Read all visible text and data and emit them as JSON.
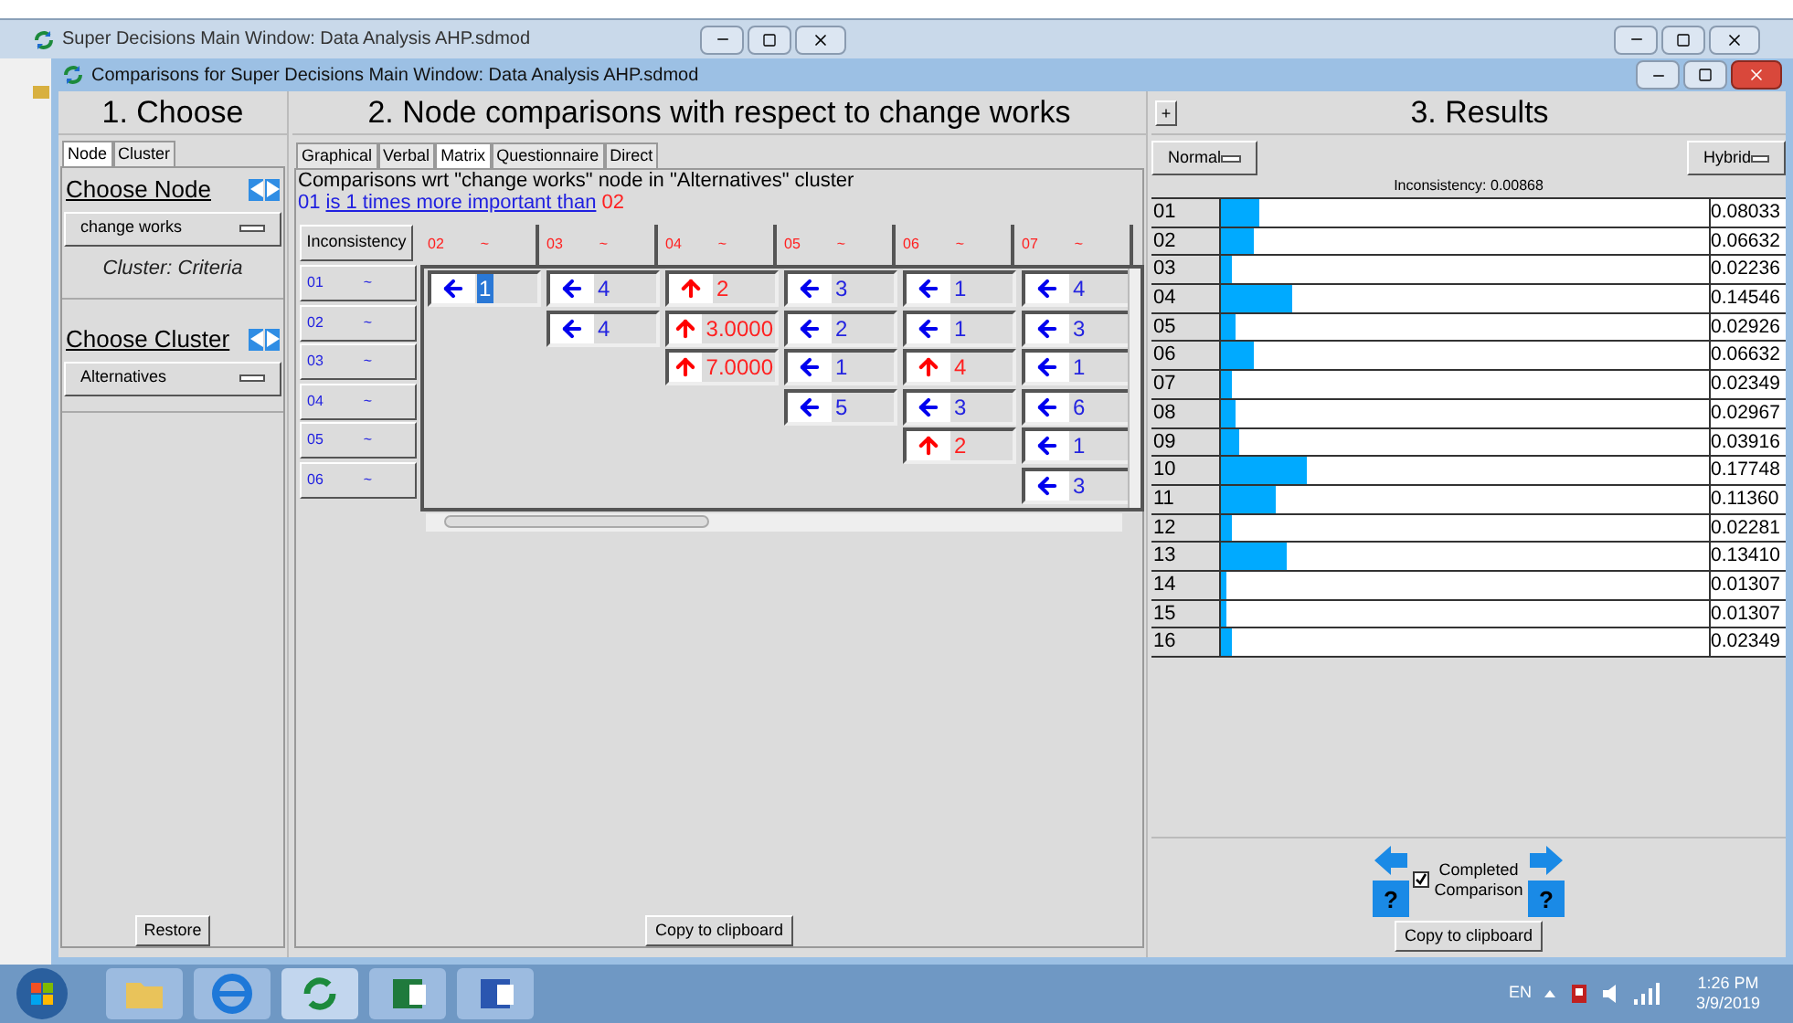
{
  "background_window": {
    "title": "Super Decisions Main Window: Data Analysis AHP.sdmod"
  },
  "window": {
    "title": "Comparisons for Super Decisions Main Window: Data Analysis AHP.sdmod"
  },
  "choose_panel": {
    "heading": "1. Choose",
    "tabs": [
      {
        "label": "Node",
        "selected": true
      },
      {
        "label": "Cluster",
        "selected": false
      }
    ],
    "node_label": "Choose Node",
    "node_dropdown": "change works",
    "cluster_caption": "Cluster: Criteria",
    "cluster_label": "Choose Cluster",
    "cluster_dropdown": "Alternatives",
    "restore_button": "Restore"
  },
  "comparison_panel": {
    "heading": "2. Node comparisons with respect to change works",
    "tabs": [
      {
        "label": "Graphical",
        "selected": false
      },
      {
        "label": "Verbal",
        "selected": false
      },
      {
        "label": "Matrix",
        "selected": true
      },
      {
        "label": "Questionnaire",
        "selected": false
      },
      {
        "label": "Direct",
        "selected": false
      }
    ],
    "description": "Comparisons wrt \"change works\" node in \"Alternatives\" cluster",
    "statement": {
      "first": "01",
      "link": "is 1 times more important than",
      "second": "02"
    },
    "inconsistency_button": "Inconsistency",
    "columns": [
      {
        "label": "02",
        "mark": "~"
      },
      {
        "label": "03",
        "mark": "~"
      },
      {
        "label": "04",
        "mark": "~"
      },
      {
        "label": "05",
        "mark": "~"
      },
      {
        "label": "06",
        "mark": "~"
      },
      {
        "label": "07",
        "mark": "~"
      }
    ],
    "rows": [
      {
        "label": "01",
        "mark": "~",
        "cells": [
          {
            "kind": "left",
            "value": "1",
            "selected": true
          },
          {
            "kind": "left",
            "value": "4",
            "selected": false
          },
          {
            "kind": "up",
            "value": "2",
            "selected": false
          },
          {
            "kind": "left",
            "value": "3",
            "selected": false
          },
          {
            "kind": "left",
            "value": "1",
            "selected": false
          },
          {
            "kind": "left",
            "value": "4",
            "selected": false
          }
        ]
      },
      {
        "label": "02",
        "mark": "~",
        "cells": [
          "",
          {
            "kind": "left",
            "value": "4",
            "selected": false
          },
          {
            "kind": "up",
            "value": "3.0000",
            "selected": false
          },
          {
            "kind": "left",
            "value": "2",
            "selected": false
          },
          {
            "kind": "left",
            "value": "1",
            "selected": false
          },
          {
            "kind": "left",
            "value": "3",
            "selected": false
          }
        ]
      },
      {
        "label": "03",
        "mark": "~",
        "cells": [
          "",
          "",
          {
            "kind": "up",
            "value": "7.0000",
            "selected": false
          },
          {
            "kind": "left",
            "value": "1",
            "selected": false
          },
          {
            "kind": "up",
            "value": "4",
            "selected": false
          },
          {
            "kind": "left",
            "value": "1",
            "selected": false
          }
        ]
      },
      {
        "label": "04",
        "mark": "~",
        "cells": [
          "",
          "",
          "",
          {
            "kind": "left",
            "value": "5",
            "selected": false
          },
          {
            "kind": "left",
            "value": "3",
            "selected": false
          },
          {
            "kind": "left",
            "value": "6",
            "selected": false
          }
        ]
      },
      {
        "label": "05",
        "mark": "~",
        "cells": [
          "",
          "",
          "",
          "",
          {
            "kind": "up",
            "value": "2",
            "selected": false
          },
          {
            "kind": "left",
            "value": "1",
            "selected": false
          }
        ]
      },
      {
        "label": "06",
        "mark": "~",
        "cells": [
          "",
          "",
          "",
          "",
          "",
          {
            "kind": "left",
            "value": "3",
            "selected": false
          }
        ]
      }
    ],
    "copy_button": "Copy to clipboard"
  },
  "results_panel": {
    "expand_button": "+",
    "heading": "3. Results",
    "mode_dropdown": "Normal",
    "type_dropdown": "Hybrid",
    "inconsistency": "Inconsistency: 0.00868",
    "rows": [
      {
        "label": "01",
        "level": 0.08,
        "value": "0.08033"
      },
      {
        "label": "02",
        "level": 0.066,
        "value": "0.06632"
      },
      {
        "label": "03",
        "level": 0.022,
        "value": "0.02236"
      },
      {
        "label": "04",
        "level": 0.145,
        "value": "0.14546"
      },
      {
        "label": "05",
        "level": 0.029,
        "value": "0.02926"
      },
      {
        "label": "06",
        "level": 0.066,
        "value": "0.06632"
      },
      {
        "label": "07",
        "level": 0.023,
        "value": "0.02349"
      },
      {
        "label": "08",
        "level": 0.03,
        "value": "0.02967"
      },
      {
        "label": "09",
        "level": 0.039,
        "value": "0.03916"
      },
      {
        "label": "10",
        "level": 0.177,
        "value": "0.17748"
      },
      {
        "label": "11",
        "level": 0.114,
        "value": "0.11360"
      },
      {
        "label": "12",
        "level": 0.023,
        "value": "0.02281"
      },
      {
        "label": "13",
        "level": 0.134,
        "value": "0.13410"
      },
      {
        "label": "14",
        "level": 0.013,
        "value": "0.01307"
      },
      {
        "label": "15",
        "level": 0.013,
        "value": "0.01307"
      },
      {
        "label": "16",
        "level": 0.023,
        "value": "0.02349"
      }
    ],
    "help_mark": "?",
    "completed_comparison": {
      "label": "Completed Comparison",
      "checked": true
    },
    "copy_button": "Copy to clipboard"
  },
  "taskbar": {
    "language": "EN",
    "time": "1:26 PM",
    "date": "3/9/2019"
  }
}
